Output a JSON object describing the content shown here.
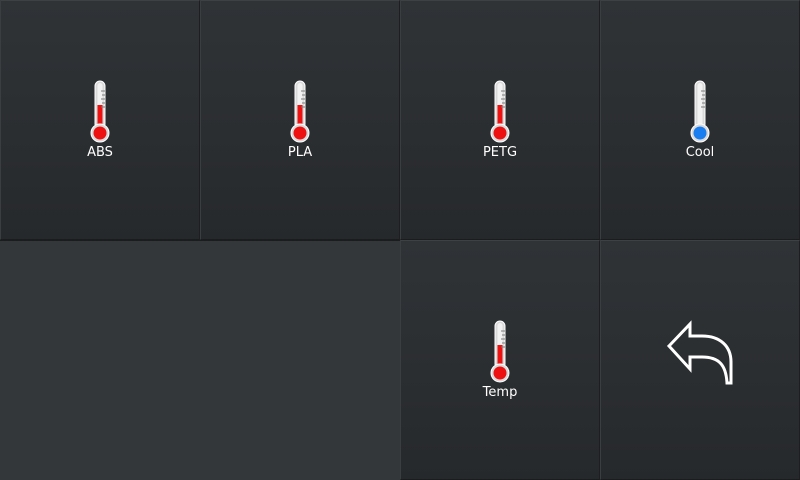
{
  "tiles": [
    {
      "label": "ABS",
      "icon": "thermometer-icon",
      "bulb_color": "#ee1111",
      "fill_level": 0.55
    },
    {
      "label": "PLA",
      "icon": "thermometer-icon",
      "bulb_color": "#ee1111",
      "fill_level": 0.55
    },
    {
      "label": "PETG",
      "icon": "thermometer-icon",
      "bulb_color": "#ee1111",
      "fill_level": 0.55
    },
    {
      "label": "Cool",
      "icon": "thermometer-icon",
      "bulb_color": "#1a7ef0",
      "fill_level": 0.0
    },
    {
      "label": "Temp",
      "icon": "thermometer-icon",
      "bulb_color": "#ee1111",
      "fill_level": 0.55
    }
  ],
  "back": {
    "icon": "back-arrow-icon"
  },
  "colors": {
    "background": "#33373a",
    "tile": "#2b2e31",
    "label_text": "#ffffff",
    "hot": "#ee1111",
    "cold": "#1a7ef0"
  }
}
